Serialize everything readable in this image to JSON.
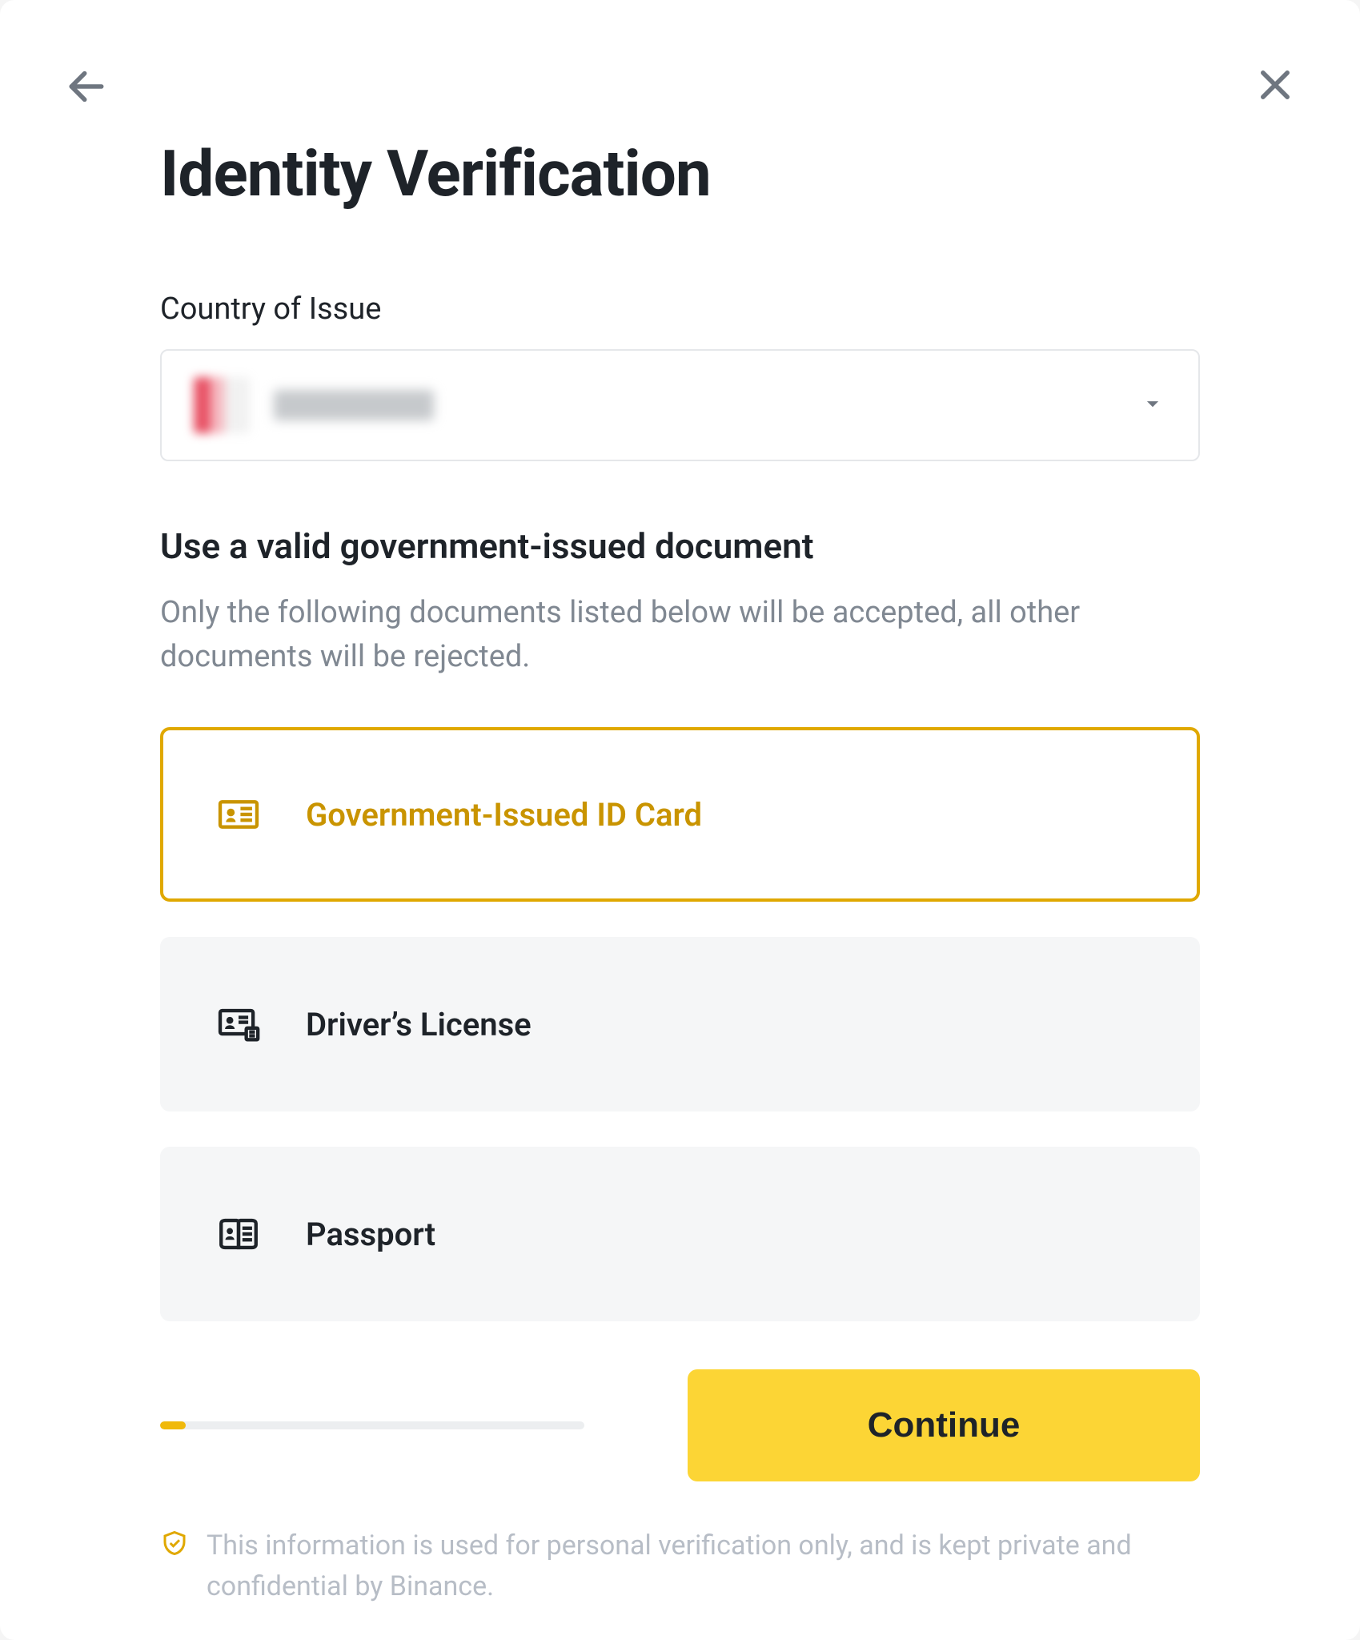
{
  "header": {
    "title": "Identity Verification"
  },
  "country": {
    "label": "Country of Issue",
    "selected_display_redacted": true
  },
  "document": {
    "heading": "Use a valid government-issued document",
    "sub": "Only the following documents listed below will be accepted, all other documents will be rejected.",
    "options": [
      {
        "id": "id-card",
        "label": "Government-Issued ID Card",
        "selected": true
      },
      {
        "id": "driver",
        "label": "Driver’s License",
        "selected": false
      },
      {
        "id": "passport",
        "label": "Passport",
        "selected": false
      }
    ]
  },
  "footer": {
    "continue_label": "Continue",
    "progress_percent": 6
  },
  "privacy": {
    "text": "This information is used for personal verification only, and is kept private and confidential by Binance."
  },
  "colors": {
    "accent": "#fcd535",
    "accent_border": "#e0a800",
    "text": "#1e2329",
    "muted": "#808892"
  }
}
